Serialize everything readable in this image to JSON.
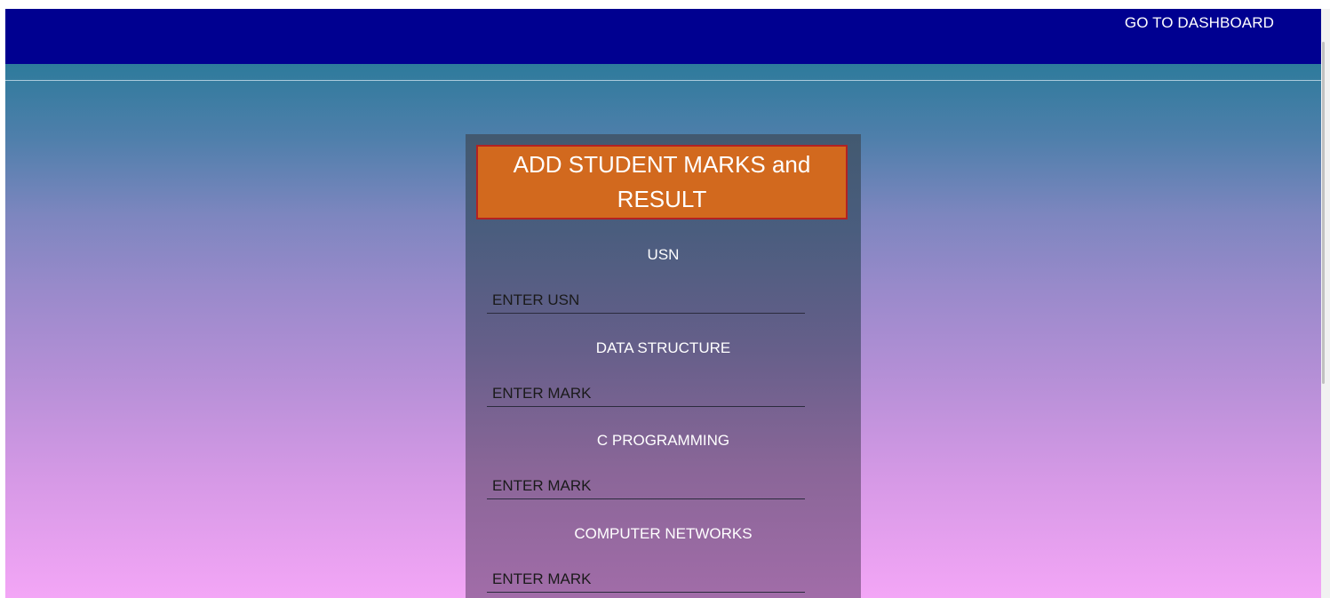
{
  "nav": {
    "dashboard_link": "GO TO DASHBOARD"
  },
  "form": {
    "title": "ADD STUDENT MARKS and RESULT",
    "fields": [
      {
        "label": "USN",
        "placeholder": "ENTER USN"
      },
      {
        "label": "DATA STRUCTURE",
        "placeholder": "ENTER MARK"
      },
      {
        "label": "C PROGRAMMING",
        "placeholder": "ENTER MARK"
      },
      {
        "label": "COMPUTER NETWORKS",
        "placeholder": "ENTER MARK"
      }
    ]
  },
  "colors": {
    "navbar": "#000090",
    "title_box": "#d2691e",
    "title_border": "#b22222"
  }
}
